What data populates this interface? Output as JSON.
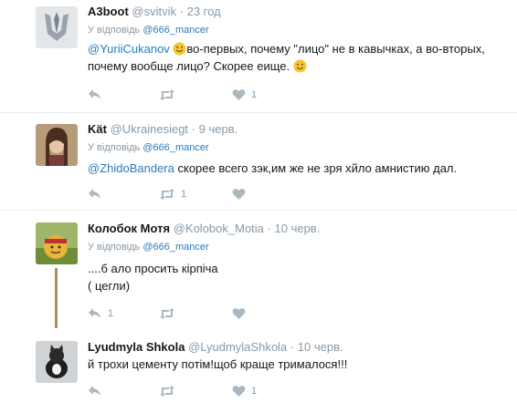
{
  "tweets": [
    {
      "name": "A3boot",
      "handle": "@svitvik",
      "time": "23 год",
      "reply_prefix": "У відповідь",
      "reply_to": "@666_mancer",
      "mention": "@YuriiCukanov",
      "text_line1": "во-первых,  почему \"лицо\" не в кавычках,  а во-вторых,",
      "text_line2_a": "почему вообще лицо? Скорее е",
      "text_line2_b": "ище.",
      "likes": "1"
    },
    {
      "name": "Kät",
      "handle": "@Ukrainesiegt",
      "time": "9 черв.",
      "reply_prefix": "У відповідь",
      "reply_to": "@666_mancer",
      "mention": "@ZhidoBandera",
      "text": " скорее всего зэк,им же не зря хйло амнистию дал.",
      "retweets": "1"
    },
    {
      "name": "Колобок Мотя",
      "handle": "@Kolobok_Motia",
      "time": "10 черв.",
      "reply_prefix": "У відповідь",
      "reply_to": "@666_mancer",
      "text_line1": "....б ало просить кірпіча",
      "text_line2": "( цегли)",
      "replies": "1"
    },
    {
      "name": "Lyudmyla Shkola",
      "handle": "@LyudmylaShkola",
      "time": "10 черв.",
      "text": "й трохи цементу потім!щоб краще трималося!!!",
      "likes": "1"
    }
  ],
  "icons": [
    "reply-icon",
    "retweet-icon",
    "heart-icon",
    "smile-emoji-icon"
  ],
  "colors": {
    "link": "#2b7bb9",
    "meta": "#8899a6",
    "icon": "#aab8c2",
    "divider": "#e6ecf0"
  }
}
